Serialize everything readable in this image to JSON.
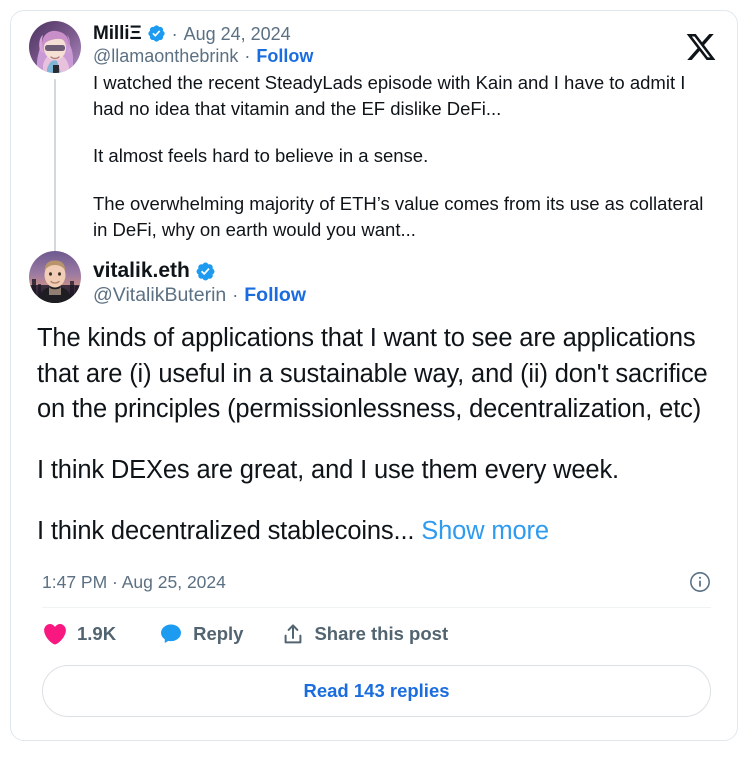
{
  "card": {
    "brand_logo": "x-logo",
    "accent_link_color": "#1b6ddf",
    "verified_badge_color": "#1d9bf0",
    "like_color": "#f91880",
    "reply_color": "#1d9bf0",
    "text_color": "#0f1419",
    "muted_color": "#5b7083",
    "border_color": "#e1e8ed"
  },
  "parent_tweet": {
    "avatar_name": "avatar-milliE",
    "display_name": "MilliΞ",
    "verified": true,
    "verified_icon": "verified-badge-icon",
    "separator": "·",
    "date": "Aug 24, 2024",
    "handle": "@llamaonthebrink",
    "follow_label": "Follow",
    "paragraphs": [
      "I watched the recent SteadyLads episode with Kain and I have to admit I had no idea that vitamin and the EF dislike DeFi...",
      "It almost feels hard to believe in a sense.",
      "The overwhelming majority of ETH’s value comes from its use as collateral in DeFi, why on earth would you want..."
    ]
  },
  "main_tweet": {
    "avatar_name": "avatar-vitalik",
    "display_name": "vitalik.eth",
    "verified": true,
    "verified_icon": "verified-badge-icon",
    "separator": "·",
    "handle": "@VitalikButerin",
    "follow_label": "Follow",
    "paragraphs": [
      "The kinds of applications that I want to see are applications that are (i) useful in a sustainable way, and (ii) don't sacrifice on the principles (permissionlessness, decentralization, etc)",
      "I think DEXes are great, and I use them every week."
    ],
    "last_paragraph_text": "I think decentralized stablecoins... ",
    "show_more_label": "Show more",
    "timestamp": "1:47 PM · Aug 25, 2024",
    "info_icon": "info-circle-icon"
  },
  "actions": {
    "like": {
      "icon": "heart-icon",
      "label": "1.9K"
    },
    "reply": {
      "icon": "comment-icon",
      "label": "Reply"
    },
    "share": {
      "icon": "share-icon",
      "label": "Share this post"
    }
  },
  "footer": {
    "read_replies_label": "Read 143 replies"
  }
}
